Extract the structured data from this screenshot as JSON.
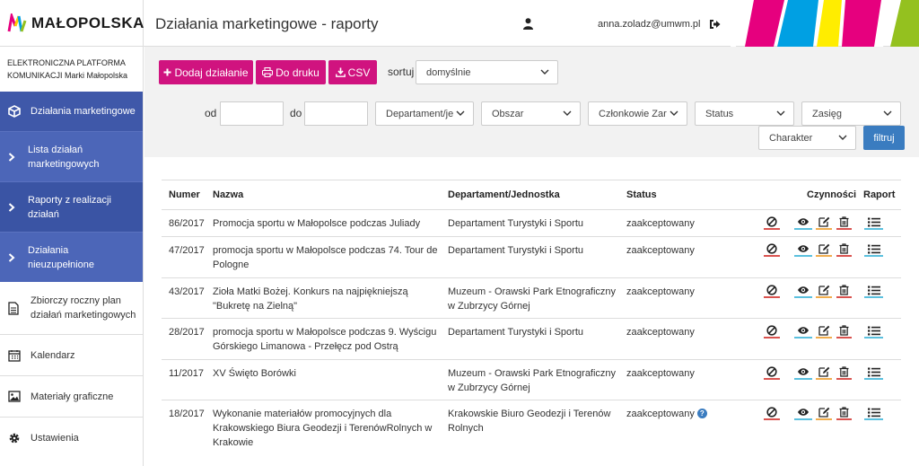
{
  "brand": {
    "logo_text": "MAŁOPOLSKA",
    "stripe_colors": [
      "#e6007e",
      "#00a0e3",
      "#ffed00",
      "#e6007e",
      "#94c11f"
    ]
  },
  "header": {
    "title": "Działania marketingowe - raporty",
    "user_email": "anna.zoladz@umwm.pl"
  },
  "sidebar": {
    "platform_line1": "ELEKTRONICZNA PLATFORMA",
    "platform_line2": "KOMUNIKACJI Marki Małopolska",
    "items": [
      {
        "label": "Działania marketingowe",
        "icon": "cube-icon"
      },
      {
        "label1": "Lista działań",
        "label2": "marketingowych",
        "icon": "chevron-right-icon"
      },
      {
        "label1": "Raporty z realizacji",
        "label2": "działań",
        "icon": "chevron-right-icon"
      },
      {
        "label1": "Działania",
        "label2": "nieuzupełnione",
        "icon": "chevron-right-icon"
      },
      {
        "label1": "Zbiorczy roczny plan",
        "label2": "działań marketingowych",
        "icon": "document-icon"
      },
      {
        "label": "Kalendarz",
        "icon": "calendar-icon"
      },
      {
        "label": "Materiały graficzne",
        "icon": "image-icon"
      },
      {
        "label": "Ustawienia",
        "icon": "gear-icon"
      }
    ]
  },
  "toolbar": {
    "add_label": "Dodaj działanie",
    "print_label": "Do druku",
    "csv_label": "CSV",
    "sort_label": "sortuj",
    "sort_value": "domyślnie"
  },
  "filters": {
    "from_label": "od",
    "to_label": "do",
    "department": "Departament/je",
    "area": "Obszar",
    "members": "Członkowie Zar",
    "status": "Status",
    "range": "Zasięg",
    "character": "Charakter",
    "filter_button": "filtruj"
  },
  "table": {
    "columns": {
      "number": "Numer",
      "name": "Nazwa",
      "department": "Departament/Jednostka",
      "status": "Status",
      "actions": "Czynności",
      "report": "Raport"
    },
    "rows": [
      {
        "number": "86/2017",
        "name1": "Promocja sportu w Małopolsce podczas Juliady",
        "name2": "",
        "dept1": "Departament Turystyki i Sportu",
        "dept2": "",
        "status": "zaakceptowany",
        "help": false
      },
      {
        "number": "47/2017",
        "name1": "promocja sportu w Małopolsce podczas 74. Tour de",
        "name2": "Pologne",
        "dept1": "Departament Turystyki i Sportu",
        "dept2": "",
        "status": "zaakceptowany",
        "help": false
      },
      {
        "number": "43/2017",
        "name1": "Zioła Matki Bożej. Konkurs na najpiękniejszą",
        "name2": "\"Bukretę na Zielną\"",
        "dept1": "Muzeum - Orawski Park Etnograficzny",
        "dept2": "w Zubrzycy Górnej",
        "status": "zaakceptowany",
        "help": false
      },
      {
        "number": "28/2017",
        "name1": "promocja sportu w Małopolsce podczas 9. Wyścigu",
        "name2": "Górskiego Limanowa - Przełęcz pod Ostrą",
        "dept1": "Departament Turystyki i Sportu",
        "dept2": "",
        "status": "zaakceptowany",
        "help": false
      },
      {
        "number": "11/2017",
        "name1": "XV Święto Borówki",
        "name2": "",
        "dept1": "Muzeum - Orawski Park Etnograficzny",
        "dept2": "w Zubrzycy Górnej",
        "status": "zaakceptowany",
        "help": false
      },
      {
        "number": "18/2017",
        "name1": "Wykonanie materiałów promocyjnych dla",
        "name2": "Krakowskiego Biura Geodezji i TerenówRolnych w",
        "name3": "Krakowie",
        "dept1": "Krakowskie Biuro Geodezji i Terenów",
        "dept2": "Rolnych",
        "status": "zaakceptowany",
        "help": true,
        "help_mark": "?"
      }
    ]
  }
}
